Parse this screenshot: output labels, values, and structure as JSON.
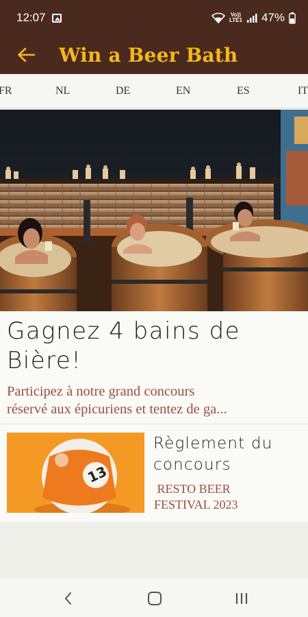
{
  "status": {
    "time": "12:07",
    "volte": "Vo))",
    "lte": "LTE1",
    "battery": "47%"
  },
  "appbar": {
    "title": "Win a Beer Bath"
  },
  "languages": [
    "FR",
    "NL",
    "DE",
    "EN",
    "ES",
    "IT"
  ],
  "article": {
    "headline": "Gagnez 4 bains de Bière!",
    "excerpt_line1": "Participez à notre grand concours",
    "excerpt_line2": "réservé aux épicuriens et tentez de ga..."
  },
  "related": {
    "title": "Règlement du concours",
    "subtitle_line1": " RESTO BEER",
    "subtitle_line2": "FESTIVAL 2023",
    "ball_number": "13"
  },
  "colors": {
    "brand_brown": "#4a2a1f",
    "title_gold": "#f4b81c",
    "excerpt_red": "#9a4f3f"
  }
}
